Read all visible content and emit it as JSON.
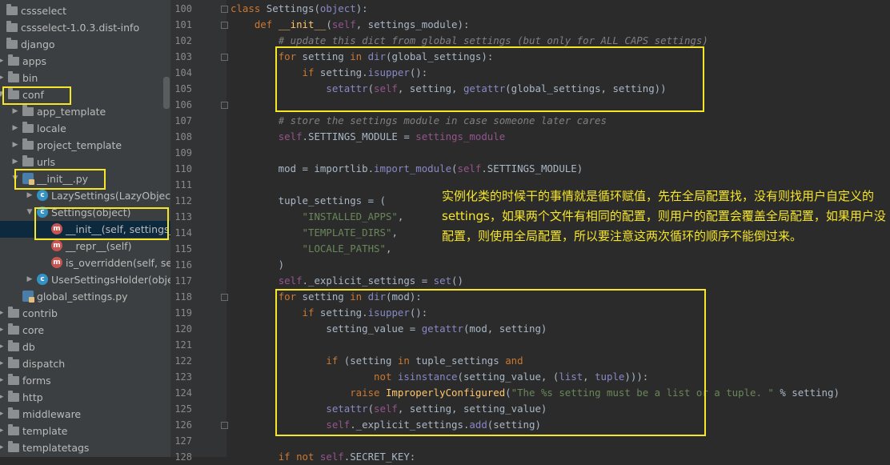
{
  "sidebar": {
    "items": [
      {
        "label": "cssselect",
        "type": "folder",
        "arrow": "none",
        "indent": 0
      },
      {
        "label": "cssselect-1.0.3.dist-info",
        "type": "folder",
        "arrow": "none",
        "indent": 0
      },
      {
        "label": "django",
        "type": "folder",
        "arrow": "none",
        "indent": 0
      },
      {
        "label": "apps",
        "type": "folder",
        "arrow": "right",
        "indent": 1
      },
      {
        "label": "bin",
        "type": "folder",
        "arrow": "right",
        "indent": 1
      },
      {
        "label": "conf",
        "type": "folder",
        "arrow": "down",
        "indent": 1
      },
      {
        "label": "app_template",
        "type": "folder",
        "arrow": "right",
        "indent": 2
      },
      {
        "label": "locale",
        "type": "folder",
        "arrow": "right",
        "indent": 2
      },
      {
        "label": "project_template",
        "type": "folder",
        "arrow": "right",
        "indent": 2
      },
      {
        "label": "urls",
        "type": "folder",
        "arrow": "right",
        "indent": 2
      },
      {
        "label": "__init__.py",
        "type": "py",
        "arrow": "down",
        "indent": 2
      },
      {
        "label": "LazySettings(LazyObject)",
        "type": "class",
        "arrow": "right",
        "indent": 3
      },
      {
        "label": "Settings(object)",
        "type": "class",
        "arrow": "down",
        "indent": 3
      },
      {
        "label": "__init__(self, settings_module)",
        "type": "method",
        "arrow": "none",
        "indent": 4
      },
      {
        "label": "__repr__(self)",
        "type": "method",
        "arrow": "none",
        "indent": 4
      },
      {
        "label": "is_overridden(self, setting)",
        "type": "method",
        "arrow": "none",
        "indent": 4
      },
      {
        "label": "UserSettingsHolder(object)",
        "type": "class",
        "arrow": "right",
        "indent": 3
      },
      {
        "label": "global_settings.py",
        "type": "py",
        "arrow": "none",
        "indent": 2
      },
      {
        "label": "contrib",
        "type": "folder",
        "arrow": "right",
        "indent": 1
      },
      {
        "label": "core",
        "type": "folder",
        "arrow": "right",
        "indent": 1
      },
      {
        "label": "db",
        "type": "folder",
        "arrow": "right",
        "indent": 1
      },
      {
        "label": "dispatch",
        "type": "folder",
        "arrow": "right",
        "indent": 1
      },
      {
        "label": "forms",
        "type": "folder",
        "arrow": "right",
        "indent": 1
      },
      {
        "label": "http",
        "type": "folder",
        "arrow": "right",
        "indent": 1
      },
      {
        "label": "middleware",
        "type": "folder",
        "arrow": "right",
        "indent": 1
      },
      {
        "label": "template",
        "type": "folder",
        "arrow": "right",
        "indent": 1
      },
      {
        "label": "templatetags",
        "type": "folder",
        "arrow": "right",
        "indent": 1
      }
    ],
    "selected_index": 13
  },
  "editor": {
    "line_numbers": [
      "100",
      "101",
      "102",
      "103",
      "104",
      "105",
      "106",
      "107",
      "108",
      "109",
      "110",
      "111",
      "112",
      "113",
      "114",
      "115",
      "116",
      "117",
      "118",
      "119",
      "120",
      "121",
      "122",
      "123",
      "124",
      "125",
      "126",
      "127",
      "128"
    ],
    "lines": [
      [
        [
          "kw",
          "class "
        ],
        [
          "cls",
          "Settings"
        ],
        [
          "",
          "("
        ],
        [
          "bi",
          "object"
        ],
        [
          "",
          "):"
        ]
      ],
      [
        [
          "",
          "    "
        ],
        [
          "kw",
          "def "
        ],
        [
          "fn",
          "__init__"
        ],
        [
          "",
          "("
        ],
        [
          "slf",
          "self"
        ],
        [
          "",
          ", settings_module):"
        ]
      ],
      [
        [
          "",
          "        "
        ],
        [
          "cm",
          "# update this dict from global settings (but only for ALL CAPS settings)"
        ]
      ],
      [
        [
          "",
          "        "
        ],
        [
          "kw",
          "for "
        ],
        [
          "",
          "setting "
        ],
        [
          "kw",
          "in "
        ],
        [
          "bi",
          "dir"
        ],
        [
          "",
          "(global_settings):"
        ]
      ],
      [
        [
          "",
          "            "
        ],
        [
          "kw",
          "if "
        ],
        [
          "",
          "setting."
        ],
        [
          "bi",
          "isupper"
        ],
        [
          "",
          "():"
        ]
      ],
      [
        [
          "",
          "                "
        ],
        [
          "bi",
          "setattr"
        ],
        [
          "",
          "("
        ],
        [
          "slf",
          "self"
        ],
        [
          "",
          ", setting, "
        ],
        [
          "bi",
          "getattr"
        ],
        [
          "",
          "(global_settings, setting))"
        ]
      ],
      [
        [
          "",
          ""
        ]
      ],
      [
        [
          "",
          "        "
        ],
        [
          "cm",
          "# store the settings module in case someone later cares"
        ]
      ],
      [
        [
          "",
          "        "
        ],
        [
          "slf",
          "self"
        ],
        [
          "",
          ".SETTINGS_MODULE = "
        ],
        [
          "slf",
          "settings_module"
        ]
      ],
      [
        [
          "",
          ""
        ]
      ],
      [
        [
          "",
          "        mod = importlib."
        ],
        [
          "bi",
          "import_module"
        ],
        [
          "",
          "("
        ],
        [
          "slf",
          "self"
        ],
        [
          "",
          ".SETTINGS_MODULE)"
        ]
      ],
      [
        [
          "",
          ""
        ]
      ],
      [
        [
          "",
          "        tuple_settings = ("
        ]
      ],
      [
        [
          "",
          "            "
        ],
        [
          "str",
          "\"INSTALLED_APPS\""
        ],
        [
          "",
          ","
        ]
      ],
      [
        [
          "",
          "            "
        ],
        [
          "str",
          "\"TEMPLATE_DIRS\""
        ],
        [
          "",
          ","
        ]
      ],
      [
        [
          "",
          "            "
        ],
        [
          "str",
          "\"LOCALE_PATHS\""
        ],
        [
          "",
          ","
        ]
      ],
      [
        [
          "",
          "        )"
        ]
      ],
      [
        [
          "",
          "        "
        ],
        [
          "slf",
          "self"
        ],
        [
          "",
          "._explicit_settings = "
        ],
        [
          "bi",
          "set"
        ],
        [
          "",
          "()"
        ]
      ],
      [
        [
          "",
          "        "
        ],
        [
          "kw",
          "for "
        ],
        [
          "",
          "setting "
        ],
        [
          "kw",
          "in "
        ],
        [
          "bi",
          "dir"
        ],
        [
          "",
          "(mod):"
        ]
      ],
      [
        [
          "",
          "            "
        ],
        [
          "kw",
          "if "
        ],
        [
          "",
          "setting."
        ],
        [
          "bi",
          "isupper"
        ],
        [
          "",
          "():"
        ]
      ],
      [
        [
          "",
          "                setting_value = "
        ],
        [
          "bi",
          "getattr"
        ],
        [
          "",
          "(mod, setting)"
        ]
      ],
      [
        [
          "",
          ""
        ]
      ],
      [
        [
          "",
          "                "
        ],
        [
          "kw",
          "if "
        ],
        [
          "",
          "(setting "
        ],
        [
          "kw",
          "in "
        ],
        [
          "",
          "tuple_settings "
        ],
        [
          "kw",
          "and"
        ]
      ],
      [
        [
          "",
          "                        "
        ],
        [
          "kw",
          "not "
        ],
        [
          "bi",
          "isinstance"
        ],
        [
          "",
          "(setting_value, ("
        ],
        [
          "bi",
          "list"
        ],
        [
          "",
          ", "
        ],
        [
          "bi",
          "tuple"
        ],
        [
          "",
          ")))"
        ],
        [
          "",
          ":"
        ]
      ],
      [
        [
          "",
          "                    "
        ],
        [
          "kw",
          "raise "
        ],
        [
          "fn",
          "ImproperlyConfigured"
        ],
        [
          "",
          "("
        ],
        [
          "str",
          "\"The %s setting must be a list or a tuple. \""
        ],
        [
          "",
          " % setting)"
        ]
      ],
      [
        [
          "",
          "                "
        ],
        [
          "bi",
          "setattr"
        ],
        [
          "",
          "("
        ],
        [
          "slf",
          "self"
        ],
        [
          "",
          ", setting, setting_value)"
        ]
      ],
      [
        [
          "",
          "                "
        ],
        [
          "slf",
          "self"
        ],
        [
          "",
          "._explicit_settings."
        ],
        [
          "bi",
          "add"
        ],
        [
          "",
          "(setting)"
        ]
      ],
      [
        [
          "",
          ""
        ]
      ],
      [
        [
          "",
          "        "
        ],
        [
          "kw",
          "if not "
        ],
        [
          "slf",
          "self"
        ],
        [
          "",
          ".SECRET_KEY:"
        ]
      ]
    ]
  },
  "annotation": {
    "text": "实例化类的时候干的事情就是循环赋值，先在全局配置找，没有则找用户自定义的settings，如果两个文件有相同的配置，则用户的配置会覆盖全局配置，如果用户没配置，则使用全局配置，所以要注意这两次循环的顺序不能倒过来。"
  },
  "colors": {
    "highlight": "#f6e62a",
    "sidebar_bg": "#3c3f41",
    "editor_bg": "#2b2b2b",
    "selection": "#0d293e"
  }
}
